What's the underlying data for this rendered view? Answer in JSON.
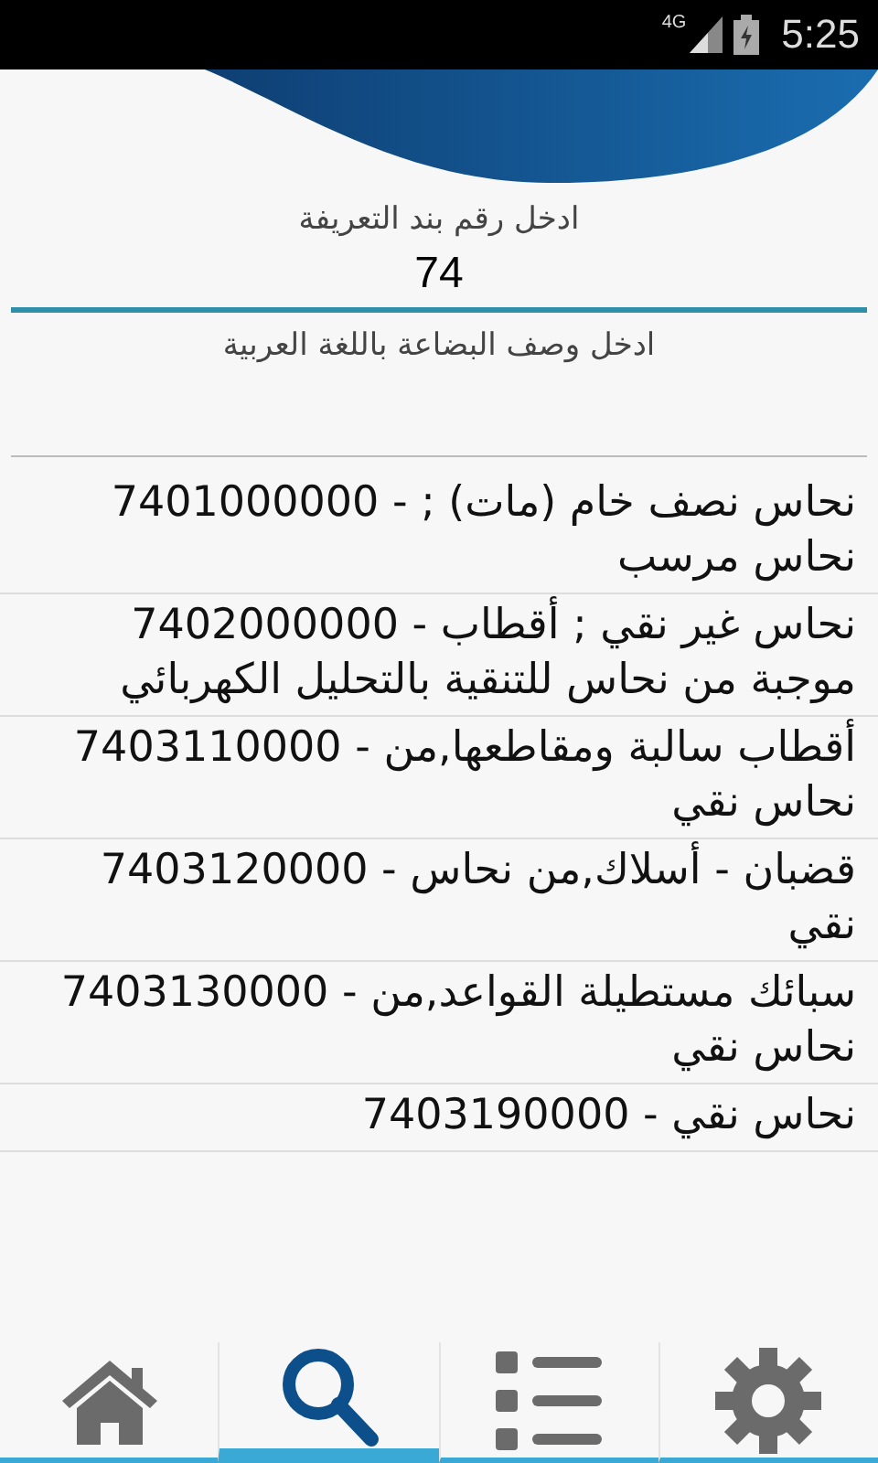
{
  "status_bar": {
    "network": "4G",
    "time": "5:25"
  },
  "search": {
    "code_label": "ادخل رقم بند التعريفة",
    "code_value": "74",
    "description_placeholder": "ادخل وصف البضاعة باللغة العربية"
  },
  "results": [
    {
      "text": "7401000000 - نحاس نصف خام (مات) ; نحاس مرسب"
    },
    {
      "text": "7402000000 - نحاس غير نقي ; أقطاب موجبة من نحاس  للتنقية بالتحليل الكهربائي"
    },
    {
      "text": "7403110000 - أقطاب سالبة ومقاطعها,من نحاس نقي"
    },
    {
      "text": "7403120000 - قضبان - أسلاك,من نحاس نقي"
    },
    {
      "text": "7403130000 - سبائك مستطيلة القواعد,من نحاس نقي"
    },
    {
      "text": "7403190000 - نحاس نقي"
    }
  ],
  "nav": [
    {
      "kind": "home",
      "selected": false
    },
    {
      "kind": "search",
      "selected": true
    },
    {
      "kind": "list",
      "selected": false
    },
    {
      "kind": "settings",
      "selected": false
    }
  ]
}
